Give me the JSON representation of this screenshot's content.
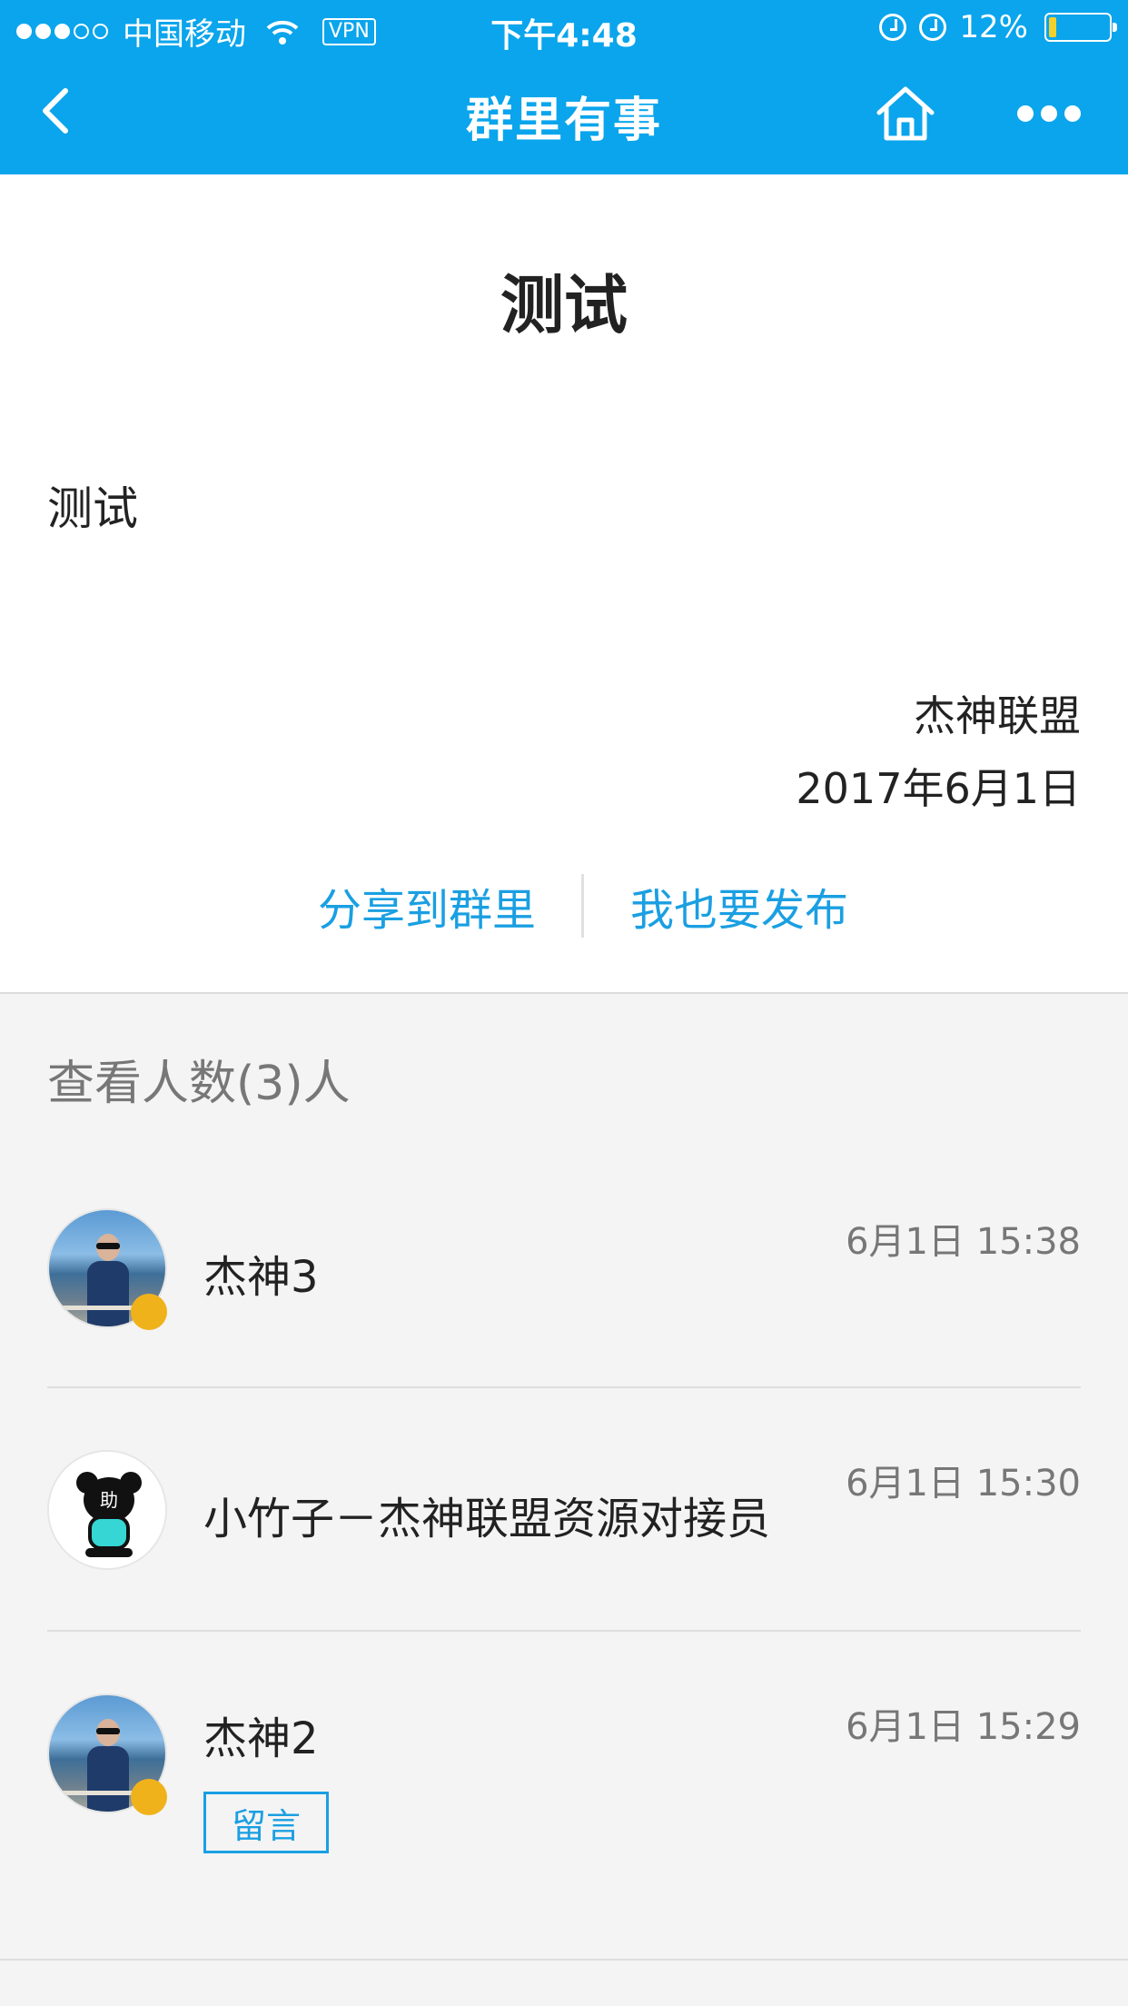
{
  "status_bar": {
    "carrier": "中国移动",
    "vpn": "VPN",
    "time": "下午4:48",
    "battery": "12%",
    "battery_level": 0.12
  },
  "nav": {
    "title": "群里有事",
    "back_icon": "chevron-left-icon",
    "home_icon": "home-icon",
    "more_icon": "more-dots-icon"
  },
  "post": {
    "title": "测试",
    "body": "测试",
    "author": "杰神联盟",
    "date": "2017年6月1日",
    "share_label": "分享到群里",
    "publish_label": "我也要发布"
  },
  "viewers": {
    "title": "查看人数(3)人",
    "items": [
      {
        "name": "杰神3",
        "time": "6月1日 15:38"
      },
      {
        "name": "小竹子－杰神联盟资源对接员",
        "time": "6月1日 15:30",
        "avatar_text": "助"
      },
      {
        "name": "杰神2",
        "time": "6月1日 15:29",
        "action_label": "留言"
      }
    ]
  },
  "colors": {
    "accent": "#0aa5ec",
    "link": "#1a9fe2",
    "badge": "#f0b21a"
  }
}
